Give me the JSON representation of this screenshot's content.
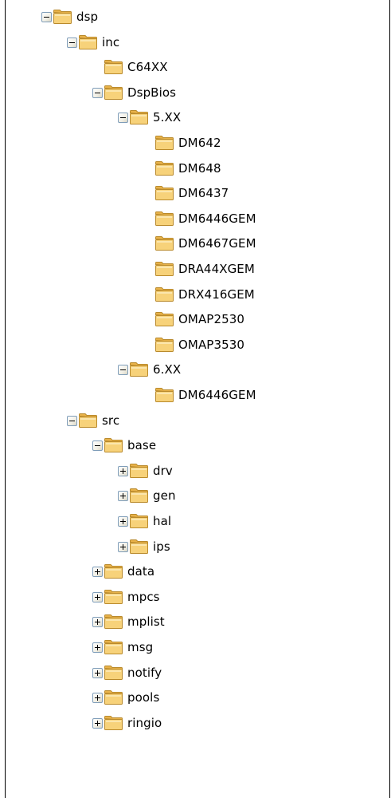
{
  "colors": {
    "folder_front": "#f7d27a",
    "folder_back": "#e8b24a",
    "folder_outline": "#b98a2c",
    "expander_border": "#7f9db9",
    "frame": "#000000"
  },
  "tree": [
    {
      "label": "dsp",
      "level": 0,
      "expander": "minus",
      "icon": "folder-open-icon"
    },
    {
      "label": "inc",
      "level": 1,
      "expander": "minus",
      "icon": "folder-open-icon"
    },
    {
      "label": "C64XX",
      "level": 2,
      "expander": "none",
      "icon": "folder-icon"
    },
    {
      "label": "DspBios",
      "level": 2,
      "expander": "minus",
      "icon": "folder-open-icon"
    },
    {
      "label": "5.XX",
      "level": 3,
      "expander": "minus",
      "icon": "folder-open-icon"
    },
    {
      "label": "DM642",
      "level": 4,
      "expander": "none",
      "icon": "folder-icon"
    },
    {
      "label": "DM648",
      "level": 4,
      "expander": "none",
      "icon": "folder-icon"
    },
    {
      "label": "DM6437",
      "level": 4,
      "expander": "none",
      "icon": "folder-icon"
    },
    {
      "label": "DM6446GEM",
      "level": 4,
      "expander": "none",
      "icon": "folder-icon"
    },
    {
      "label": "DM6467GEM",
      "level": 4,
      "expander": "none",
      "icon": "folder-icon"
    },
    {
      "label": "DRA44XGEM",
      "level": 4,
      "expander": "none",
      "icon": "folder-icon"
    },
    {
      "label": "DRX416GEM",
      "level": 4,
      "expander": "none",
      "icon": "folder-icon"
    },
    {
      "label": "OMAP2530",
      "level": 4,
      "expander": "none",
      "icon": "folder-icon"
    },
    {
      "label": "OMAP3530",
      "level": 4,
      "expander": "none",
      "icon": "folder-icon"
    },
    {
      "label": "6.XX",
      "level": 3,
      "expander": "minus",
      "icon": "folder-open-icon"
    },
    {
      "label": "DM6446GEM",
      "level": 4,
      "expander": "none",
      "icon": "folder-icon"
    },
    {
      "label": "src",
      "level": 1,
      "expander": "minus",
      "icon": "folder-open-icon"
    },
    {
      "label": "base",
      "level": 2,
      "expander": "minus",
      "icon": "folder-open-icon"
    },
    {
      "label": "drv",
      "level": 3,
      "expander": "plus",
      "icon": "folder-icon"
    },
    {
      "label": "gen",
      "level": 3,
      "expander": "plus",
      "icon": "folder-icon"
    },
    {
      "label": "hal",
      "level": 3,
      "expander": "plus",
      "icon": "folder-icon"
    },
    {
      "label": "ips",
      "level": 3,
      "expander": "plus",
      "icon": "folder-icon"
    },
    {
      "label": "data",
      "level": 2,
      "expander": "plus",
      "icon": "folder-icon"
    },
    {
      "label": "mpcs",
      "level": 2,
      "expander": "plus",
      "icon": "folder-icon"
    },
    {
      "label": "mplist",
      "level": 2,
      "expander": "plus",
      "icon": "folder-icon"
    },
    {
      "label": "msg",
      "level": 2,
      "expander": "plus",
      "icon": "folder-icon"
    },
    {
      "label": "notify",
      "level": 2,
      "expander": "plus",
      "icon": "folder-icon"
    },
    {
      "label": "pools",
      "level": 2,
      "expander": "plus",
      "icon": "folder-icon"
    },
    {
      "label": "ringio",
      "level": 2,
      "expander": "plus",
      "icon": "folder-icon"
    }
  ]
}
